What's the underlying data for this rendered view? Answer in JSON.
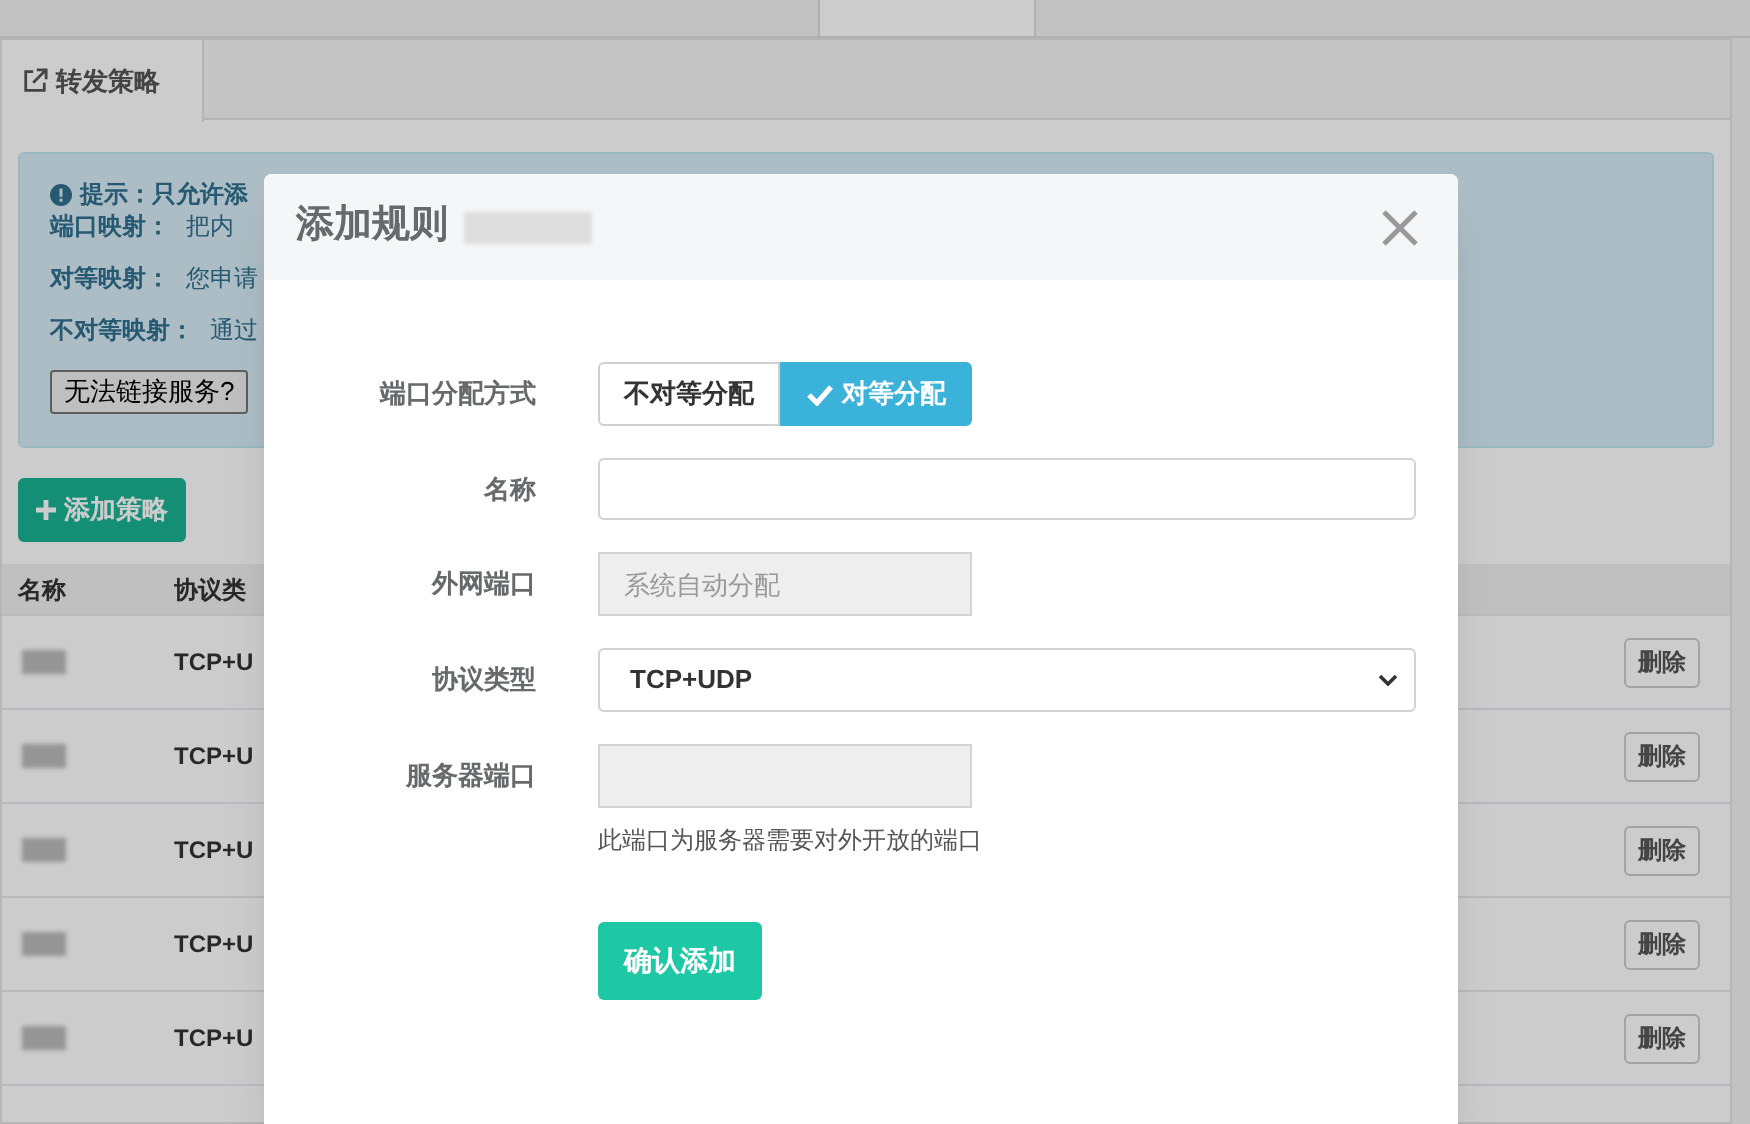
{
  "background": {
    "tab": {
      "label": "转发策略"
    },
    "notice": {
      "title": "提示：只允许添",
      "lines": [
        {
          "label": "端口映射：",
          "text": "把内"
        },
        {
          "label": "对等映射：",
          "text": "您申请"
        },
        {
          "label": "不对等映射：",
          "text": "通过"
        }
      ],
      "help_button": "无法链接服务?"
    },
    "add_button": "添加策略",
    "table": {
      "columns": [
        "名称",
        "协议类"
      ],
      "rows": [
        {
          "protocol": "TCP+U",
          "action": "删除"
        },
        {
          "protocol": "TCP+U",
          "action": "删除"
        },
        {
          "protocol": "TCP+U",
          "action": "删除"
        },
        {
          "protocol": "TCP+U",
          "action": "删除"
        },
        {
          "protocol": "TCP+U",
          "action": "删除"
        }
      ]
    }
  },
  "dialog": {
    "title": "添加规则",
    "fields": [
      {
        "kind": "toggle",
        "label": "端口分配方式",
        "options": [
          {
            "label": "不对等分配",
            "selected": false
          },
          {
            "label": "对等分配",
            "selected": true
          }
        ]
      },
      {
        "kind": "text",
        "label": "名称"
      },
      {
        "kind": "disabled",
        "label": "外网端口",
        "placeholder": "系统自动分配"
      },
      {
        "kind": "select",
        "label": "协议类型",
        "value": "TCP+UDP"
      },
      {
        "kind": "disabled",
        "label": "服务器端口",
        "help": "此端口为服务器需要对外开放的端口"
      }
    ],
    "submit": "确认添加"
  }
}
